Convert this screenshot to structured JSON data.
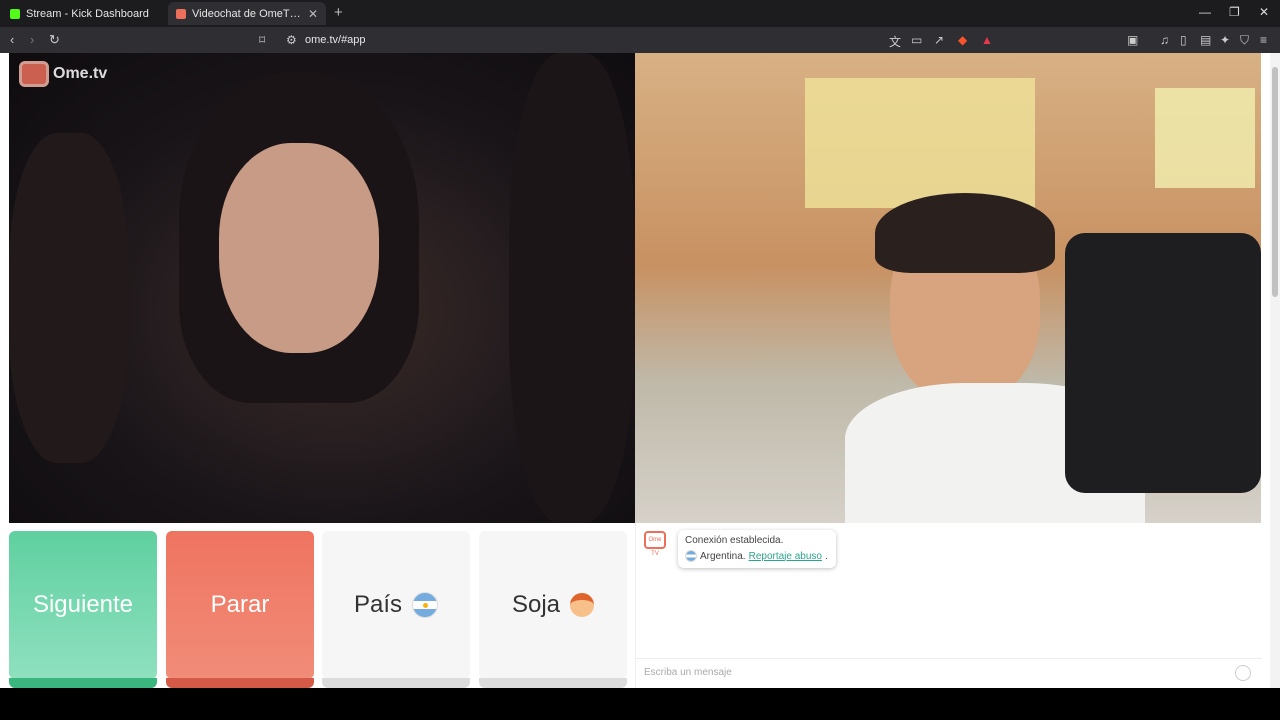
{
  "browser": {
    "tabs": [
      {
        "title": "Stream - Kick Dashboard",
        "favicon_color": "#53fc18"
      },
      {
        "title": "Videochat de OmeTV — Alte",
        "favicon_color": "#ec6f5b"
      }
    ],
    "url": "ome.tv/#app"
  },
  "logo": {
    "text": "Ome.tv"
  },
  "buttons": {
    "next": "Siguiente",
    "stop": "Parar",
    "country": "País",
    "gender": "Soja"
  },
  "chat": {
    "logo_text": "Ome TV",
    "status": "Conexión establecida.",
    "country": "Argentina.",
    "report_link": "Reportaje abuso",
    "report_suffix": ".",
    "input_placeholder": "Escriba un mensaje"
  },
  "colors": {
    "next": "#5fd0a0",
    "stop": "#ef7460",
    "accent": "#2aa58b"
  }
}
